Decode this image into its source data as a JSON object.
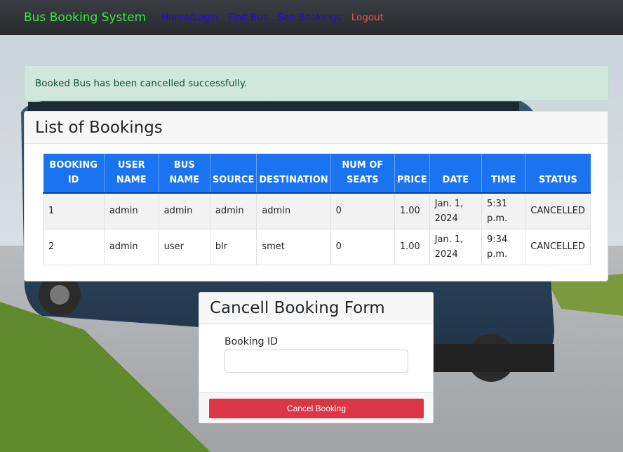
{
  "navbar": {
    "brand": "Bus Booking System",
    "links": [
      {
        "label": "Home/Login"
      },
      {
        "label": "Find Bus"
      },
      {
        "label": "See Bookings"
      },
      {
        "label": "Logout"
      }
    ]
  },
  "alert": {
    "message": "Booked Bus has been cancelled successfully."
  },
  "bookings": {
    "title": "List of Bookings",
    "columns": [
      "BOOKING ID",
      "USER NAME",
      "BUS NAME",
      "SOURCE",
      "DESTINATION",
      "NUM OF SEATS",
      "PRICE",
      "DATE",
      "TIME",
      "STATUS"
    ],
    "rows": [
      [
        "1",
        "admin",
        "admin",
        "admin",
        "admin",
        "0",
        "1.00",
        "Jan. 1, 2024",
        "5:31 p.m.",
        "CANCELLED"
      ],
      [
        "2",
        "admin",
        "user",
        "blr",
        "smet",
        "0",
        "1.00",
        "Jan. 1, 2024",
        "9:34 p.m.",
        "CANCELLED"
      ]
    ]
  },
  "cancel_form": {
    "title": "Cancell Booking Form",
    "booking_id_label": "Booking ID",
    "booking_id_value": "",
    "submit_label": "Cancel Booking"
  },
  "colors": {
    "brand": "#39e83e",
    "nav_link": "#2200ff",
    "logout": "#ff4a4a",
    "table_header": "#1a73f0",
    "danger": "#dc3545",
    "alert_bg": "#d1e7dd"
  }
}
